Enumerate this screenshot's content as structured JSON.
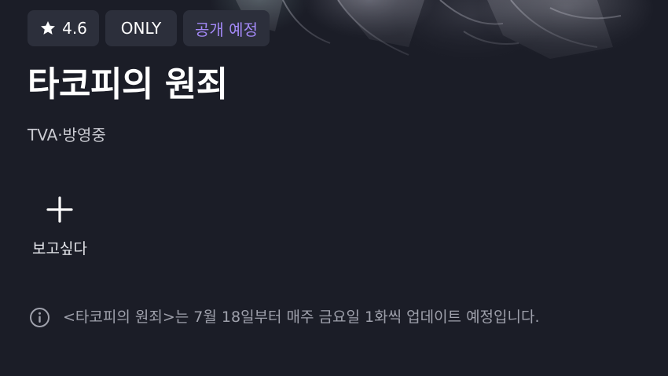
{
  "badges": {
    "rating": "4.6",
    "only": "ONLY",
    "upcoming": "공개 예정"
  },
  "title": "타코피의 원죄",
  "subtitle": "TVA·방영중",
  "wishlist": {
    "label": "보고싶다"
  },
  "notice": {
    "text": "<타코피의 원죄>는 7월 18일부터 매주 금요일 1화씩 업데이트 예정입니다."
  },
  "colors": {
    "background": "#1b1d27",
    "badge_bg": "#2c2f3b",
    "upcoming_accent": "#a288f5",
    "notice_text": "#9fa1ac"
  },
  "icons": [
    "star-icon",
    "plus-icon",
    "info-icon"
  ]
}
